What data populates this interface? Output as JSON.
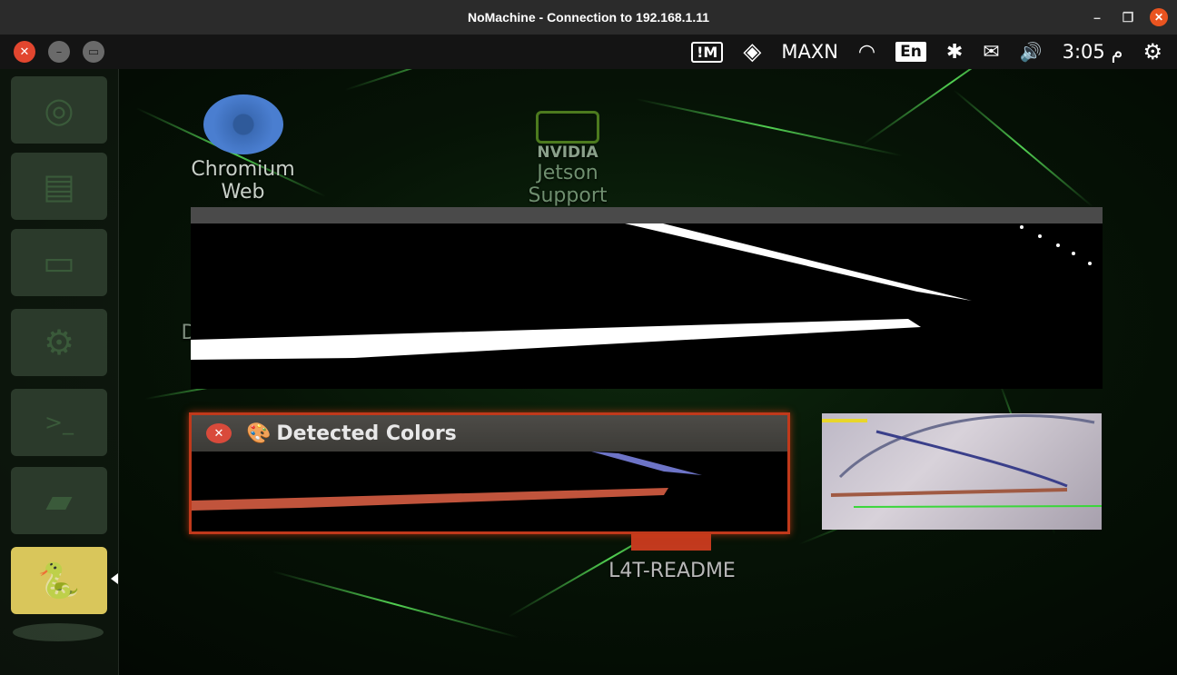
{
  "nomachine_window": {
    "title": "NoMachine - Connection to 192.168.1.11",
    "controls": {
      "minimize": "–",
      "restore": "❐",
      "close": "✕"
    }
  },
  "panel": {
    "window_controls": [
      "✕",
      "–",
      "▭"
    ],
    "indicators": {
      "nomachine_icon": "!M",
      "nvidia_glyph": "◈",
      "power_mode": "MAXN",
      "wifi": "◠",
      "keyboard": "En",
      "bluetooth": "✱",
      "mail": "✉",
      "volume": "🔊",
      "clock": "3:05 م",
      "session": "⚙"
    }
  },
  "launcher": {
    "items": [
      {
        "icon": "ubuntu-icon",
        "glyph": "◎"
      },
      {
        "icon": "document-icon",
        "glyph": "▤"
      },
      {
        "icon": "files-icon",
        "glyph": "▭"
      },
      {
        "icon": "settings-icon",
        "glyph": "⚙"
      },
      {
        "icon": "terminal-icon",
        "glyph": ">_"
      },
      {
        "icon": "editor-icon",
        "glyph": "▰"
      },
      {
        "icon": "python-icon",
        "glyph": "🐍"
      }
    ]
  },
  "desktop": {
    "icons": [
      {
        "name": "chromium",
        "label": "Chromium Web"
      },
      {
        "name": "nvidia-jetson",
        "badge": "NVIDIA",
        "label": "Jetson Support"
      },
      {
        "name": "l4t-readme",
        "label": "L4T-README"
      }
    ],
    "partial_icon_letter": "D"
  },
  "detected_window": {
    "title": "Detected Colors",
    "close": "✕",
    "title_icon": "🎨"
  },
  "colors": {
    "accent": "#e95420",
    "detected_border": "#c0391b",
    "green_strands": "#5ae65a"
  }
}
